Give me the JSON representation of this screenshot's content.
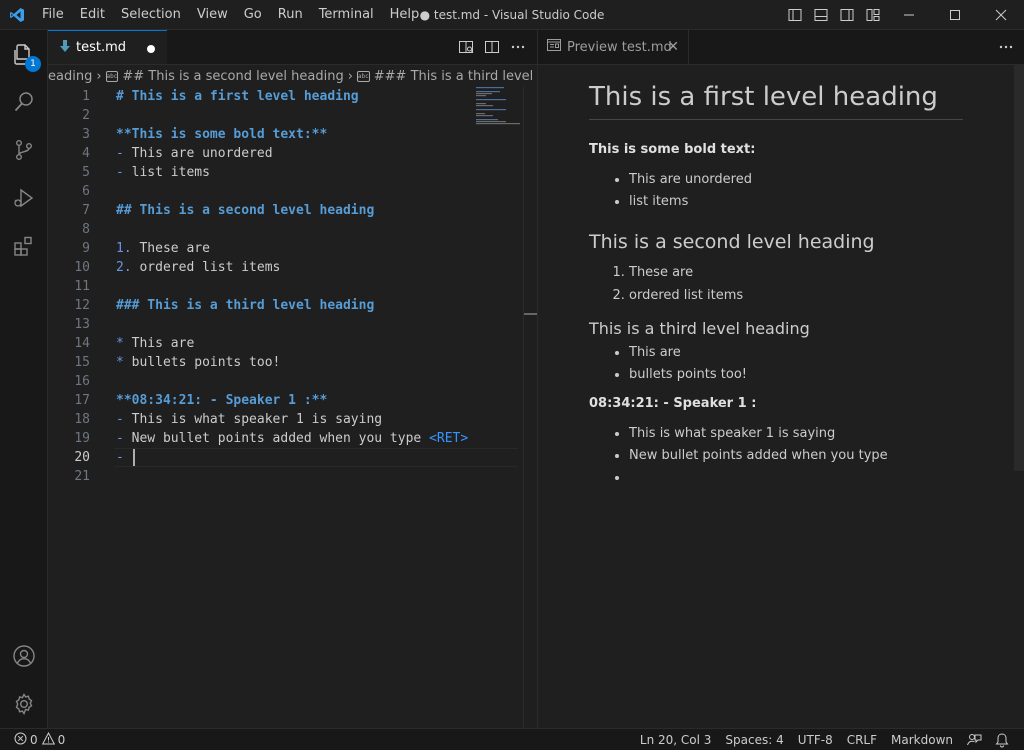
{
  "window": {
    "title": "● test.md - Visual Studio Code",
    "menu": [
      "File",
      "Edit",
      "Selection",
      "View",
      "Go",
      "Run",
      "Terminal",
      "Help"
    ]
  },
  "activity_bar": {
    "explorer_badge": "1"
  },
  "editor": {
    "tab_label": "test.md",
    "breadcrumbs": [
      "eading",
      "## This is a second level heading",
      "### This is a third level heading"
    ],
    "cursor_line": 20,
    "lines": [
      {
        "num": "1",
        "text": "# This is a first level heading"
      },
      {
        "num": "2",
        "text": ""
      },
      {
        "num": "3",
        "text": "**This is some bold text:**"
      },
      {
        "num": "4",
        "marker": "-",
        "text": "This are unordered"
      },
      {
        "num": "5",
        "marker": "-",
        "text": "list items"
      },
      {
        "num": "6",
        "text": ""
      },
      {
        "num": "7",
        "text": "## This is a second level heading"
      },
      {
        "num": "8",
        "text": ""
      },
      {
        "num": "9",
        "marker": "1.",
        "text": "These are"
      },
      {
        "num": "10",
        "marker": "2.",
        "text": "ordered list items"
      },
      {
        "num": "11",
        "text": ""
      },
      {
        "num": "12",
        "text": "### This is a third level heading"
      },
      {
        "num": "13",
        "text": ""
      },
      {
        "num": "14",
        "marker": "*",
        "text": "This are"
      },
      {
        "num": "15",
        "marker": "*",
        "text": "bullets points too!"
      },
      {
        "num": "16",
        "text": ""
      },
      {
        "num": "17",
        "text": "**08:34:21: - Speaker 1 :**"
      },
      {
        "num": "18",
        "marker": "-",
        "text": "This is what speaker 1 is saying"
      },
      {
        "num": "19",
        "marker": "-",
        "text": "New bullet points added when you type ",
        "tag": "<RET>"
      },
      {
        "num": "20",
        "marker": "-",
        "text": ""
      },
      {
        "num": "21",
        "text": ""
      }
    ]
  },
  "preview": {
    "tab_label": "Preview test.md",
    "h1": "This is a first level heading",
    "bold_text": "This is some bold text:",
    "unordered": [
      "This are unordered",
      "list items"
    ],
    "h2": "This is a second level heading",
    "ordered": [
      "These are",
      "ordered list items"
    ],
    "h3": "This is a third level heading",
    "bullets": [
      "This are",
      "bullets points too!"
    ],
    "speaker": "08:34:21: - Speaker 1 :",
    "speaker_items": [
      "This is what speaker 1 is saying",
      "New bullet points added when you type",
      ""
    ]
  },
  "status_bar": {
    "errors": "0",
    "warnings": "0",
    "position": "Ln 20, Col 3",
    "spaces": "Spaces: 4",
    "encoding": "UTF-8",
    "eol": "CRLF",
    "language": "Markdown"
  },
  "colors": {
    "accent": "#0078d4",
    "heading": "#569cd6",
    "editor_bg": "#1f1f1f",
    "chrome_bg": "#181818"
  }
}
